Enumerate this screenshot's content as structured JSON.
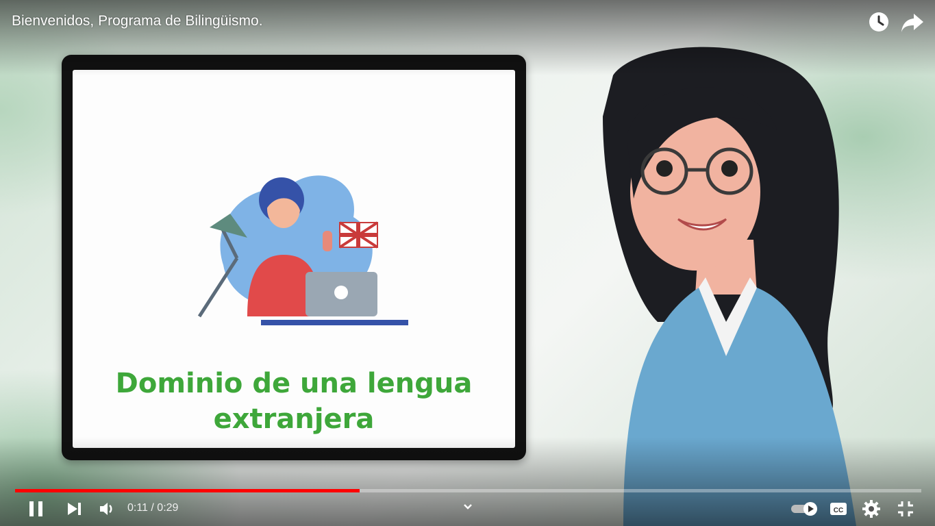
{
  "video": {
    "title": "Bienvenidos, Programa de Bilingüismo.",
    "slide_text_line1": "Dominio de una lengua",
    "slide_text_line2": "extranjera"
  },
  "controls": {
    "current_time": "0:11",
    "separator": " / ",
    "duration": "0:29",
    "progress_fraction": 0.38,
    "accent_color": "#ff0000"
  },
  "icons": {
    "watch_later": "clock-icon",
    "share": "share-arrow-icon",
    "pause": "pause-icon",
    "next": "next-icon",
    "volume": "volume-icon",
    "chapters": "chevron-down-icon",
    "autoplay": "autoplay-toggle-icon",
    "captions": "cc-icon",
    "settings": "gear-icon",
    "fullscreen_exit": "exit-fullscreen-icon"
  }
}
